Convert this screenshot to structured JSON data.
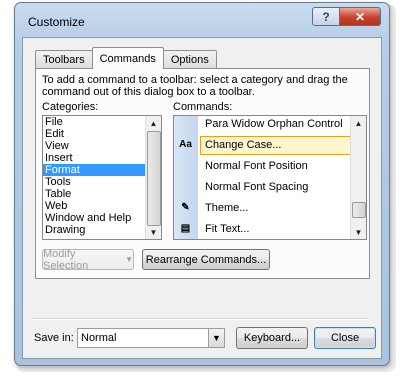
{
  "window": {
    "title": "Customize",
    "help_label": "?",
    "close_label": "✕"
  },
  "tabs": [
    {
      "label": "Toolbars",
      "active": false
    },
    {
      "label": "Commands",
      "active": true
    },
    {
      "label": "Options",
      "active": false
    }
  ],
  "instructions": "To add a command to a toolbar: select a category and drag the command out of this dialog box to a toolbar.",
  "categories": {
    "label": "Categories:",
    "items": [
      "File",
      "Edit",
      "View",
      "Insert",
      "Format",
      "Tools",
      "Table",
      "Web",
      "Window and Help",
      "Drawing"
    ],
    "selected": "Format"
  },
  "commands": {
    "label": "Commands:",
    "items": [
      {
        "label": "Para Widow Orphan Control",
        "icon": ""
      },
      {
        "label": "Change Case...",
        "icon": "change-case-icon",
        "icon_glyph": "Aa"
      },
      {
        "label": "Normal Font Position",
        "icon": ""
      },
      {
        "label": "Normal Font Spacing",
        "icon": ""
      },
      {
        "label": "Theme...",
        "icon": "theme-icon",
        "icon_glyph": "✎"
      },
      {
        "label": "Fit Text...",
        "icon": "fit-text-icon",
        "icon_glyph": "▤"
      }
    ],
    "selected": "Change Case..."
  },
  "buttons": {
    "modify_selection": "Modify Selection",
    "rearrange": "Rearrange Commands...",
    "keyboard": "Keyboard...",
    "close": "Close"
  },
  "save_in": {
    "label": "Save in:",
    "value": "Normal"
  },
  "colors": {
    "selection": "#3399ff",
    "command_highlight": "#fff6cf",
    "title_bar": "#b6cde6"
  }
}
